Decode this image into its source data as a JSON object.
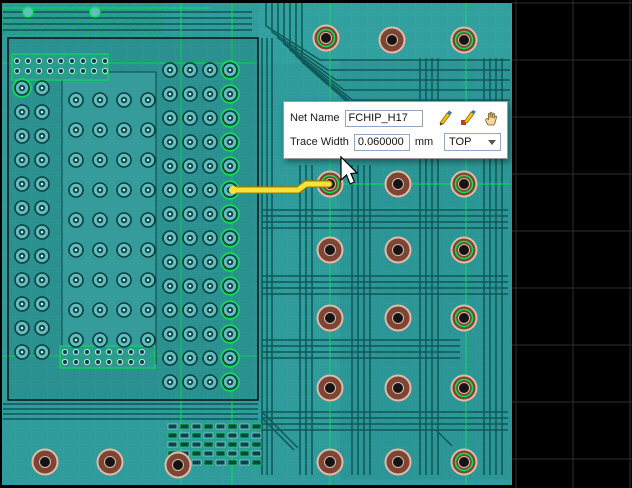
{
  "app": {
    "type": "pcb-layout-editor"
  },
  "popup": {
    "net_name_label": "Net Name",
    "net_name_value": "FCHIP_H17",
    "trace_width_label": "Trace Width",
    "trace_width_value": "0.060000",
    "unit_label": "mm",
    "layer_value": "TOP",
    "icons": [
      {
        "name": "edit-width-pen-icon"
      },
      {
        "name": "edit-net-pen-icon"
      },
      {
        "name": "move-trace-hand-icon"
      }
    ]
  },
  "board": {
    "base_color": "#2f9b9b",
    "net_highlight_color": "#0ae54f",
    "active_trace_color": "#f7e23b",
    "via_color": "#7c4636",
    "grid_color": "#2e2e2e"
  }
}
